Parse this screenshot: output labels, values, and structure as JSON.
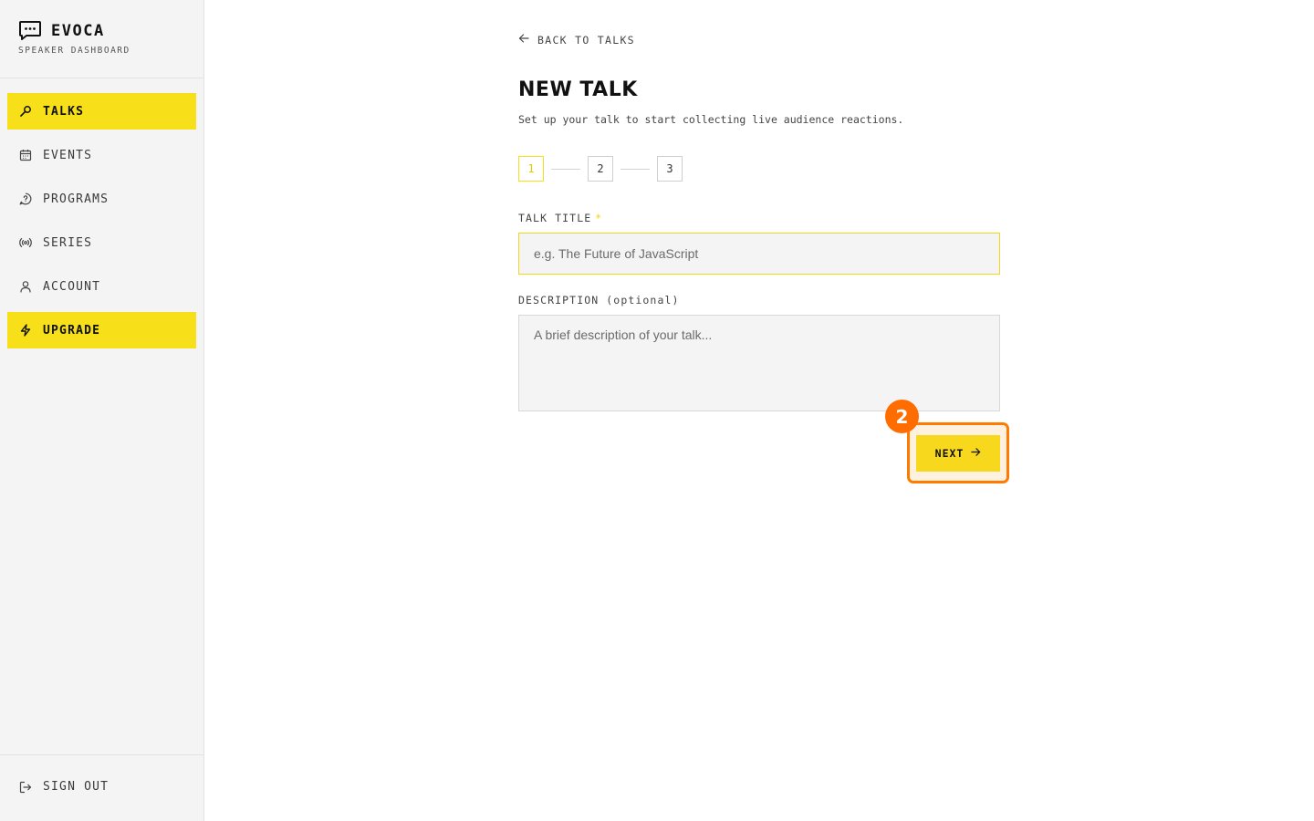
{
  "brand": {
    "name": "EVOCA",
    "subtitle": "SPEAKER DASHBOARD",
    "icon": "chat-bubble-icon"
  },
  "sidebar": {
    "items": [
      {
        "label": "TALKS",
        "icon": "microphone-icon",
        "active": true
      },
      {
        "label": "EVENTS",
        "icon": "calendar-icon",
        "active": false
      },
      {
        "label": "PROGRAMS",
        "icon": "help-circle-icon",
        "active": false
      },
      {
        "label": "SERIES",
        "icon": "broadcast-icon",
        "active": false
      },
      {
        "label": "ACCOUNT",
        "icon": "user-icon",
        "active": false
      }
    ],
    "upgrade": {
      "label": "UPGRADE",
      "icon": "lightning-icon"
    },
    "signout": {
      "label": "SIGN OUT",
      "icon": "logout-icon"
    }
  },
  "main": {
    "back_label": "BACK TO TALKS",
    "title": "NEW TALK",
    "subtitle": "Set up your talk to start collecting live audience reactions.",
    "steps": [
      "1",
      "2",
      "3"
    ],
    "current_step": 1,
    "title_field": {
      "label": "TALK TITLE",
      "required_mark": "*",
      "placeholder": "e.g. The Future of JavaScript",
      "value": ""
    },
    "description_field": {
      "label": "DESCRIPTION (optional)",
      "placeholder": "A brief description of your talk...",
      "value": ""
    },
    "next_button": {
      "label": "NEXT"
    },
    "annotation_badge": "2"
  },
  "colors": {
    "accent": "#f7e01a",
    "highlight": "#ff7a00",
    "sidebar_bg": "#f4f4f4"
  }
}
